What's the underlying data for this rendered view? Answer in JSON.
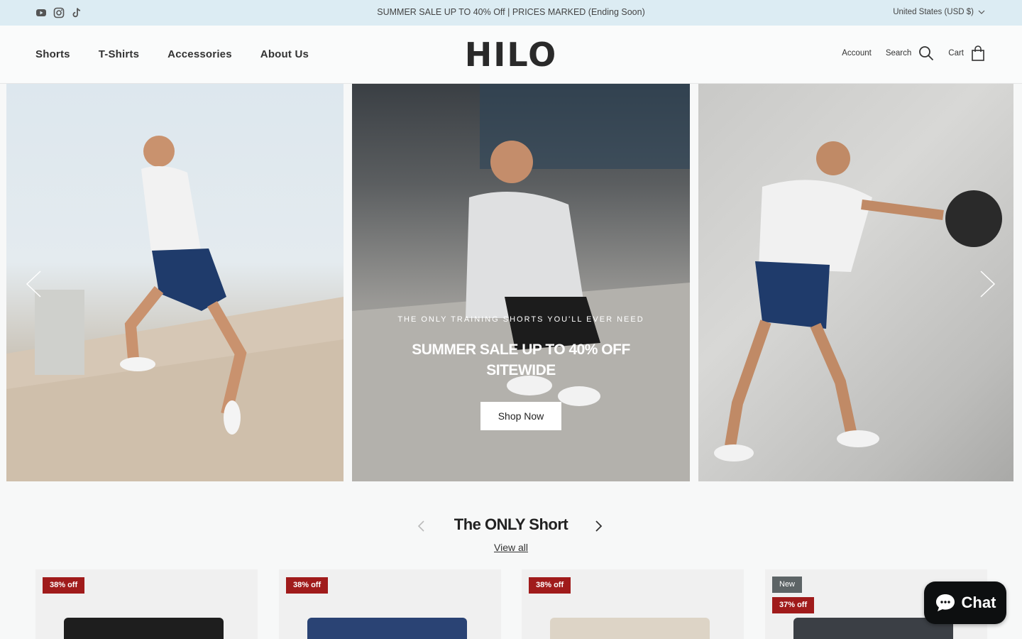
{
  "announcement": {
    "social": [
      "youtube-icon",
      "instagram-icon",
      "tiktok-icon"
    ],
    "text": "SUMMER SALE UP TO 40% Off | PRICES MARKED (Ending Soon)",
    "currency": "United States (USD $)"
  },
  "header": {
    "nav": [
      "Shorts",
      "T-Shirts",
      "Accessories",
      "About Us"
    ],
    "logo": "HILO",
    "account": "Account",
    "search": "Search",
    "cart": "Cart"
  },
  "hero": {
    "kicker": "THE ONLY TRAINING SHORTS YOU'LL EVER NEED",
    "title": "SUMMER SALE UP TO 40% OFF SITEWIDE",
    "cta": "Shop Now"
  },
  "collection": {
    "title": "The ONLY Short",
    "view_all": "View all",
    "products": [
      {
        "badges": [
          "38% off"
        ],
        "short_color": "#1e1e1e"
      },
      {
        "badges": [
          "38% off"
        ],
        "short_color": "#2a4374"
      },
      {
        "badges": [
          "38% off"
        ],
        "short_color": "#ddd4c6"
      },
      {
        "badges": [
          "New",
          "37% off"
        ],
        "short_color": "#3b3f45"
      }
    ]
  },
  "chat": {
    "label": "Chat"
  },
  "colors": {
    "announce_bg": "#dcecf3",
    "sale_badge": "#a01b1b",
    "new_badge": "#5d6466"
  }
}
